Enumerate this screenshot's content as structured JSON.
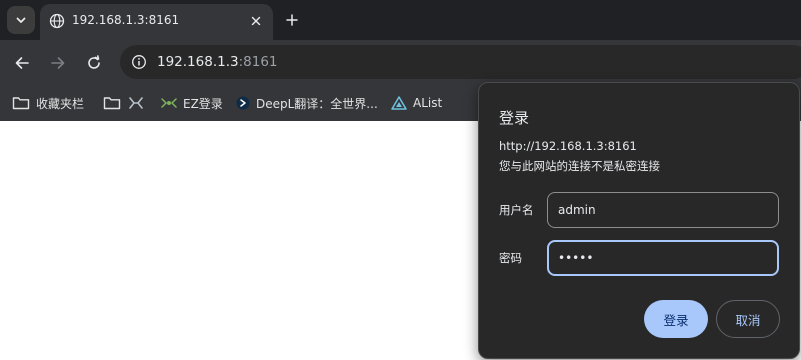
{
  "tab": {
    "title": "192.168.1.3:8161"
  },
  "omnibox": {
    "url_host": "192.168.1.3",
    "url_port": ":8161"
  },
  "bookmarks": [
    {
      "label": "收藏夹栏",
      "icon": "folder-icon"
    },
    {
      "label": "",
      "icon": "folder-icon"
    },
    {
      "label": "",
      "icon": "app-icon"
    },
    {
      "label": "EZ登录",
      "icon": "app-icon"
    },
    {
      "label": "DeepL翻译：全世界...",
      "icon": "deepl-icon"
    },
    {
      "label": "AList",
      "icon": "alist-icon"
    }
  ],
  "dialog": {
    "title": "登录",
    "origin": "http://192.168.1.3:8161",
    "warning": "您与此网站的连接不是私密连接",
    "username_label": "用户名",
    "username_value": "admin",
    "password_label": "密码",
    "password_value": "•••••",
    "ok_label": "登录",
    "cancel_label": "取消"
  },
  "colors": {
    "accent": "#a8c7fa",
    "dialog_bg": "#282828",
    "chrome_bg": "#35363a",
    "tabstrip_bg": "#202124"
  }
}
